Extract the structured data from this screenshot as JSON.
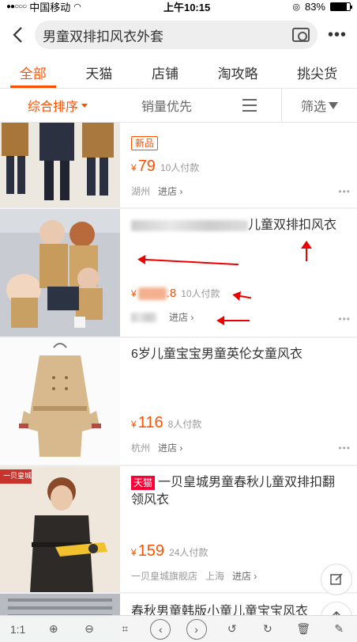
{
  "status": {
    "carrier": "中国移动",
    "time": "上午10:15",
    "battery": "83%",
    "battery_level": 0.83
  },
  "search": {
    "query": "男童双排扣风衣外套"
  },
  "tabs": [
    {
      "label": "全部"
    },
    {
      "label": "天猫"
    },
    {
      "label": "店铺"
    },
    {
      "label": "淘攻略"
    },
    {
      "label": "挑尖货"
    }
  ],
  "sort": {
    "composite": "综合排序",
    "sales": "销量优先",
    "filter": "筛选"
  },
  "products": [
    {
      "badge": "新品",
      "price": "79",
      "sold": "10人付款",
      "location": "湖州",
      "enter": "进店"
    },
    {
      "title_suffix": "儿童双排扣风衣",
      "price_suffix": ".8",
      "sold": "10人付款",
      "enter": "进店"
    },
    {
      "title": "6岁儿童宝宝男童英伦女童风衣",
      "price": "116",
      "sold": "8人付款",
      "location": "杭州",
      "enter": "进店"
    },
    {
      "tmall": "天猫",
      "title": "一贝皇城男童春秋儿童双排扣翻领风衣",
      "price": "159",
      "sold": "24人付款",
      "shop": "一贝皇城旗舰店",
      "location": "上海",
      "enter": "进店",
      "thumb_brand": "一贝皇城"
    },
    {
      "title": "春秋男童韩版小童儿童宝宝风衣"
    }
  ],
  "currency": "¥",
  "bottom": {
    "ratio": "1:1"
  },
  "colors": {
    "accent": "#ff5000",
    "tmall": "#ff0036"
  }
}
